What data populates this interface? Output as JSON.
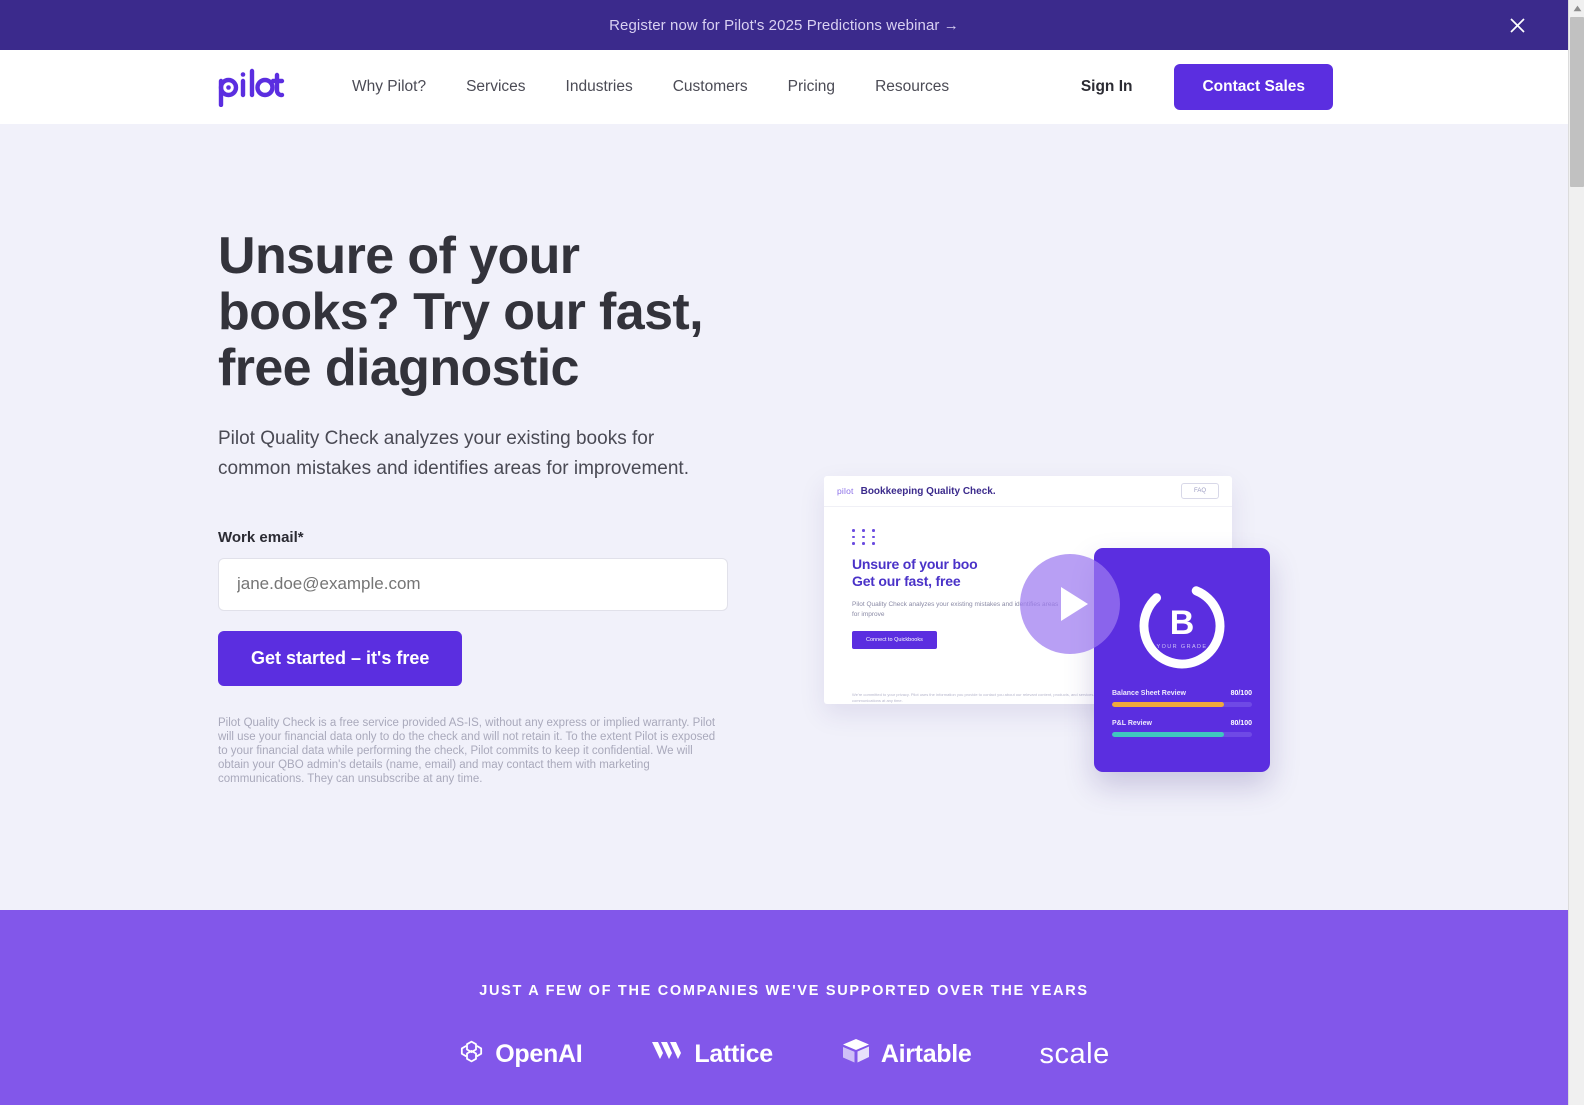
{
  "banner": {
    "text": "Register now for Pilot's 2025 Predictions webinar →",
    "close_label": "✕",
    "bg_color": "#3b2a8c"
  },
  "nav": {
    "logo_text": "pilot",
    "links": [
      {
        "label": "Why Pilot?"
      },
      {
        "label": "Services"
      },
      {
        "label": "Industries"
      },
      {
        "label": "Customers"
      },
      {
        "label": "Pricing"
      },
      {
        "label": "Resources"
      }
    ],
    "sign_in": "Sign In",
    "contact_sales": "Contact Sales",
    "accent_color": "#5b2ee0"
  },
  "hero": {
    "title": "Unsure of your books? Try our fast, free diagnostic",
    "subtitle": "Pilot Quality Check analyzes your existing books for common mistakes and identifies areas for improvement.",
    "form": {
      "label": "Work email*",
      "placeholder": "jane.doe@example.com",
      "value": "",
      "submit_label": "Get started – it's free"
    },
    "disclaimer": "Pilot Quality Check is a free service provided AS-IS, without any express or implied warranty. Pilot will use your financial data only to do the check and will not retain it. To the extent Pilot is exposed to your financial data while performing the check, Pilot commits to keep it confidential. We will obtain your QBO admin's details (name, email) and may contact them with marketing communications. They can unsubscribe at any time.",
    "background_color": "#f1f1fa"
  },
  "hero_media": {
    "browser": {
      "logo_text": "pilot",
      "title": "Bookkeeping Quality Check.",
      "faq_label": "FAQ",
      "heading_line1": "Unsure of your boo",
      "heading_line2": "Get our fast, free",
      "body": "Pilot Quality Check analyzes your existing mistakes and identifies areas for improve",
      "cta_label": "Connect to Quickbooks",
      "fine_print": "We're committed to your privacy. Pilot uses the information you provide to contact you about our relevant content, products, and services. You may unsubscribe from these communications at any time."
    },
    "grade_card": {
      "grade": "B",
      "grade_caption": "YOUR GRADE",
      "metrics": [
        {
          "label": "Balance Sheet Review",
          "score": "80/100",
          "percent": 80,
          "color": "#f0a83c"
        },
        {
          "label": "P&L Review",
          "score": "80/100",
          "percent": 80,
          "color": "#3fc6bf"
        }
      ],
      "bg_color": "#5b2ee0"
    },
    "play_button_label": "Play video"
  },
  "logo_band": {
    "title": "JUST A FEW OF THE COMPANIES WE'VE SUPPORTED OVER THE YEARS",
    "bg_color": "#8257ea",
    "logos": [
      {
        "name": "OpenAI",
        "icon": "openai-icon"
      },
      {
        "name": "Lattice",
        "icon": "lattice-icon"
      },
      {
        "name": "Airtable",
        "icon": "airtable-icon"
      },
      {
        "name": "scale",
        "icon": "scale-wordmark"
      }
    ]
  }
}
